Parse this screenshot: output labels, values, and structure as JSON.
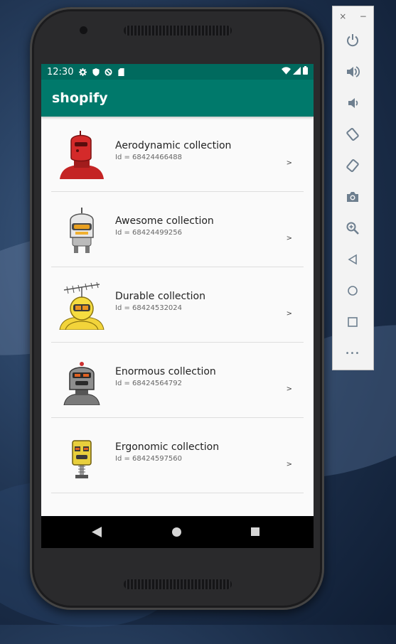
{
  "status_bar": {
    "time": "12:30"
  },
  "app_bar": {
    "title": "shopify"
  },
  "collections": [
    {
      "name": "Aerodynamic collection",
      "id_text": "Id = 68424466488",
      "chevron": ">",
      "robot_color": "#d42a2a"
    },
    {
      "name": "Awesome collection",
      "id_text": "Id = 68424499256",
      "chevron": ">",
      "robot_color": "#e6e6e6"
    },
    {
      "name": "Durable collection",
      "id_text": "Id = 68424532024",
      "chevron": ">",
      "robot_color": "#f2d43a"
    },
    {
      "name": "Enormous collection",
      "id_text": "Id = 68424564792",
      "chevron": ">",
      "robot_color": "#8a8a8a"
    },
    {
      "name": "Ergonomic collection",
      "id_text": "Id = 68424597560",
      "chevron": ">",
      "robot_color": "#e8cf3c"
    }
  ],
  "emulator_toolbar": {
    "close_label": "×",
    "minimize_label": "−",
    "more_label": "•••",
    "icons": [
      "power-icon",
      "volume-up-icon",
      "volume-down-icon",
      "rotate-left-icon",
      "rotate-right-icon",
      "camera-icon",
      "zoom-icon",
      "back-icon",
      "home-icon",
      "overview-icon",
      "more-icon"
    ]
  },
  "colors": {
    "primary": "#00796b",
    "primary_dark": "#006a5e"
  }
}
